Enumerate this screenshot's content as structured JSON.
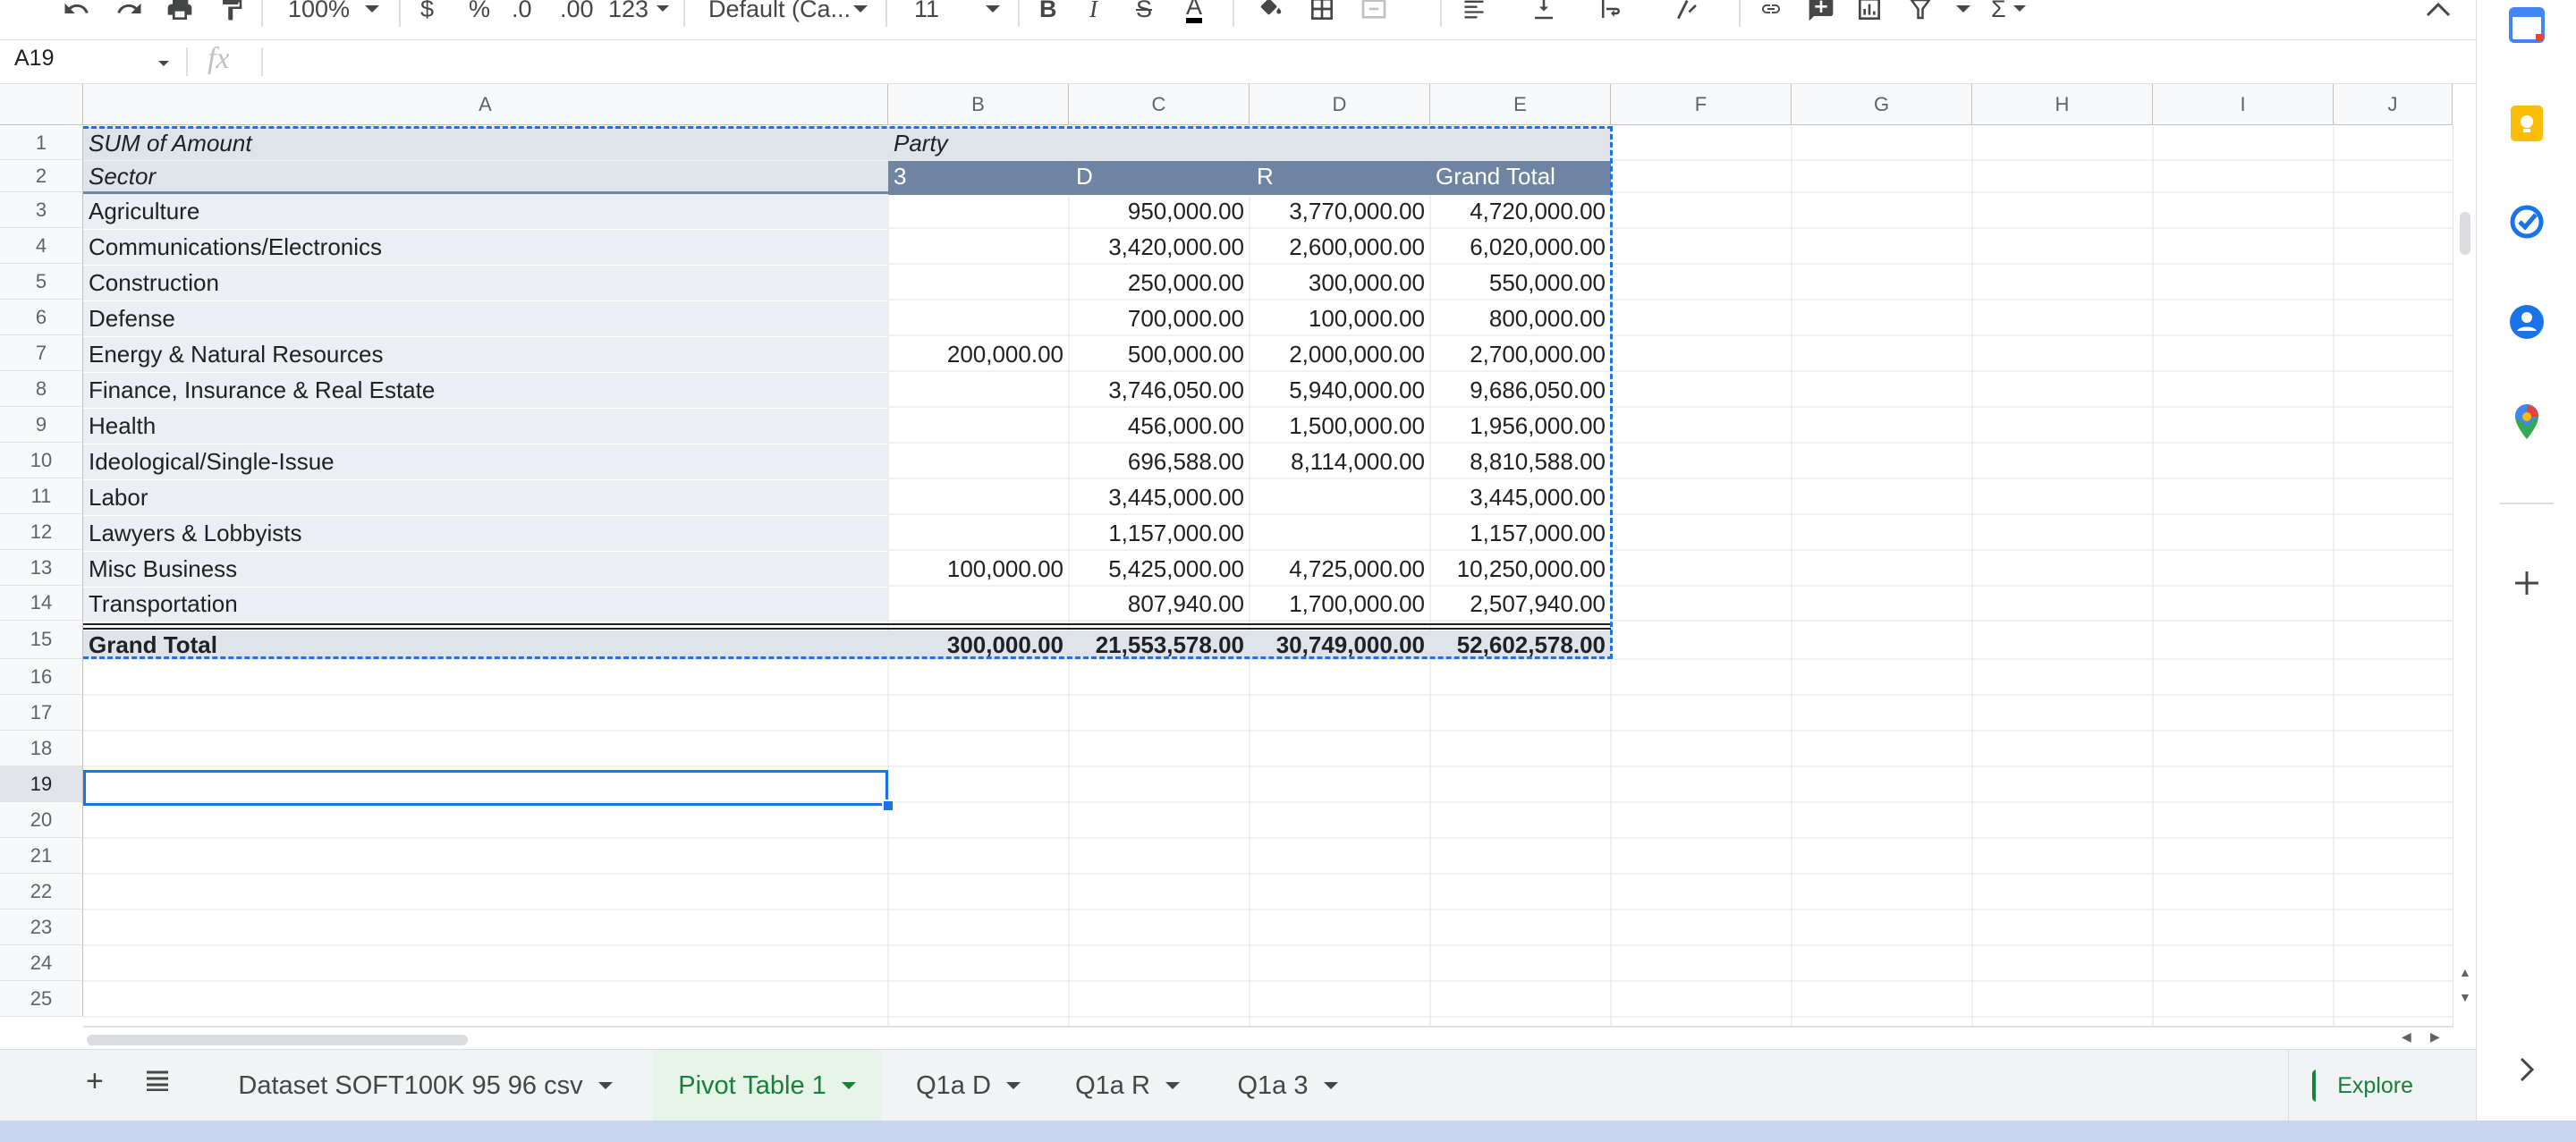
{
  "toolbar": {
    "zoom": "100%",
    "currency": "$",
    "percent": "%",
    "dec_decrease": ".0",
    "dec_increase": ".00",
    "more_formats": "123",
    "font": "Default (Ca...",
    "font_size": "11",
    "bold": "B",
    "italic": "I",
    "strike": "S",
    "textcolor": "A",
    "sum": "Σ"
  },
  "formula_bar": {
    "name_box": "A19",
    "fx": "fx",
    "value": ""
  },
  "columns": [
    {
      "label": "A"
    },
    {
      "label": "B"
    },
    {
      "label": "C"
    },
    {
      "label": "D"
    },
    {
      "label": "E"
    },
    {
      "label": "F"
    },
    {
      "label": "G"
    },
    {
      "label": "H"
    },
    {
      "label": "I"
    },
    {
      "label": "J"
    }
  ],
  "row_numbers": [
    "1",
    "2",
    "3",
    "4",
    "5",
    "6",
    "7",
    "8",
    "9",
    "10",
    "11",
    "12",
    "13",
    "14",
    "15",
    "16",
    "17",
    "18",
    "19",
    "20",
    "21",
    "22",
    "23",
    "24",
    "25"
  ],
  "selected_row": "19",
  "pivot": {
    "title": "SUM of Amount",
    "sector_label": "Sector",
    "party_label": "Party",
    "party_values": [
      "3",
      "D",
      "R"
    ],
    "grand_total_col": "Grand Total",
    "rows": [
      {
        "sector": "Agriculture",
        "v3": "",
        "d": "950,000.00",
        "r": "3,770,000.00",
        "total": "4,720,000.00"
      },
      {
        "sector": "Communications/Electronics",
        "v3": "",
        "d": "3,420,000.00",
        "r": "2,600,000.00",
        "total": "6,020,000.00"
      },
      {
        "sector": "Construction",
        "v3": "",
        "d": "250,000.00",
        "r": "300,000.00",
        "total": "550,000.00"
      },
      {
        "sector": "Defense",
        "v3": "",
        "d": "700,000.00",
        "r": "100,000.00",
        "total": "800,000.00"
      },
      {
        "sector": "Energy & Natural Resources",
        "v3": "200,000.00",
        "d": "500,000.00",
        "r": "2,000,000.00",
        "total": "2,700,000.00"
      },
      {
        "sector": "Finance, Insurance & Real Estate",
        "v3": "",
        "d": "3,746,050.00",
        "r": "5,940,000.00",
        "total": "9,686,050.00"
      },
      {
        "sector": "Health",
        "v3": "",
        "d": "456,000.00",
        "r": "1,500,000.00",
        "total": "1,956,000.00"
      },
      {
        "sector": "Ideological/Single-Issue",
        "v3": "",
        "d": "696,588.00",
        "r": "8,114,000.00",
        "total": "8,810,588.00"
      },
      {
        "sector": "Labor",
        "v3": "",
        "d": "3,445,000.00",
        "r": "",
        "total": "3,445,000.00"
      },
      {
        "sector": "Lawyers & Lobbyists",
        "v3": "",
        "d": "1,157,000.00",
        "r": "",
        "total": "1,157,000.00"
      },
      {
        "sector": "Misc Business",
        "v3": "100,000.00",
        "d": "5,425,000.00",
        "r": "4,725,000.00",
        "total": "10,250,000.00"
      },
      {
        "sector": "Transportation",
        "v3": "",
        "d": "807,940.00",
        "r": "1,700,000.00",
        "total": "2,507,940.00"
      }
    ],
    "grand_total": {
      "label": "Grand Total",
      "v3": "300,000.00",
      "d": "21,553,578.00",
      "r": "30,749,000.00",
      "total": "52,602,578.00"
    }
  },
  "sheets": [
    {
      "name": "Dataset SOFT100K 95 96 csv",
      "active": false
    },
    {
      "name": "Pivot Table 1",
      "active": true
    },
    {
      "name": "Q1a D",
      "active": false
    },
    {
      "name": "Q1a R",
      "active": false
    },
    {
      "name": "Q1a 3",
      "active": false
    }
  ],
  "explore_label": "Explore",
  "side_panel": [
    "calendar-icon",
    "keep-icon",
    "tasks-icon",
    "contacts-icon",
    "maps-icon",
    "add-icon"
  ],
  "colors": {
    "pivot_header": "#dfe4ea",
    "pivot_header_dark": "#6f84a3",
    "selection": "#1a73e8",
    "active_tab": "#188038",
    "sheet_bar": "#f1f3f4"
  }
}
